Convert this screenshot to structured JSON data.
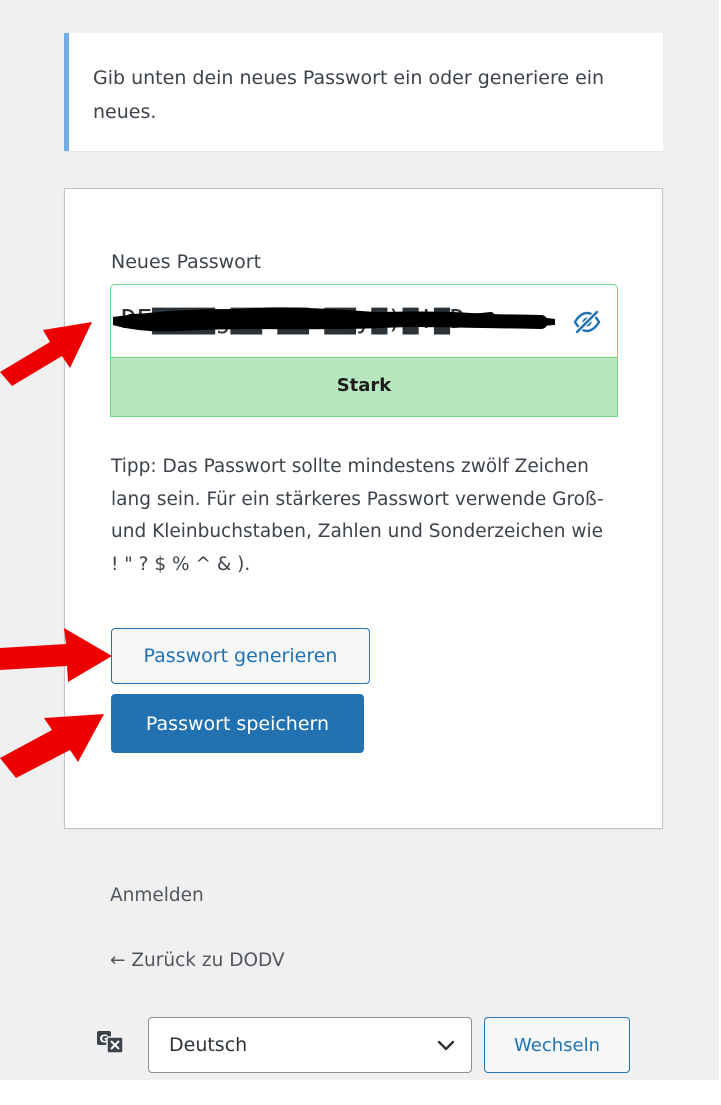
{
  "message": {
    "text": "Gib unten dein neues Passwort ein oder generiere ein neues."
  },
  "form": {
    "password_label": "Neues Passwort",
    "password_value": "DE▇▇▇▇g▇▇F▇▇S▇▇y▇)▇!▇D",
    "strength_label": "Stark",
    "hint": "Tipp: Das Passwort sollte mindestens zwölf Zeichen lang sein. Für ein stärkeres Passwort verwende Groß- und Kleinbuchstaben, Zahlen und Sonderzeichen wie ! \" ? $ % ^ & ).",
    "generate_label": "Passwort generieren",
    "save_label": "Passwort speichern"
  },
  "nav": {
    "login_label": "Anmelden",
    "back_label": "← Zurück zu DODV"
  },
  "language": {
    "selected": "Deutsch",
    "switch_label": "Wechseln"
  },
  "icons": {
    "visibility_toggle": "eye-slash-icon",
    "language": "translation-icon",
    "dropdown": "chevron-down-icon"
  },
  "colors": {
    "background": "#f0f0f1",
    "accent": "#2271b1",
    "notice_border": "#72aee6",
    "strength_fill": "#b8e6bf",
    "strength_border": "#68de7c",
    "annotation_arrow": "#ee0000"
  }
}
